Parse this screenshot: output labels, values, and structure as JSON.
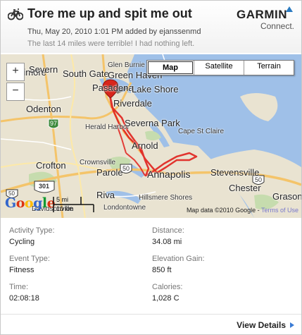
{
  "activity": {
    "title": "Tore me up and spit me out",
    "meta": "Thu, May 20, 2010 1:01 PM added by ejanssenmd",
    "description": "The last 14 miles were terrible! I had nothing left."
  },
  "logo": {
    "brand": "GARMIN",
    "sub": "Connect."
  },
  "map": {
    "type_buttons": {
      "map": "Map",
      "satellite": "Satellite",
      "terrain": "Terrain"
    },
    "zoom_in": "+",
    "zoom_out": "−",
    "google": [
      "G",
      "o",
      "o",
      "g",
      "l",
      "e"
    ],
    "google_colors": [
      "#3366cc",
      "#dd3311",
      "#ffbb00",
      "#3366cc",
      "#119933",
      "#dd3311"
    ],
    "scale_mi": "5 mi",
    "scale_km": "10 km",
    "attribution": "Map data ©2010 Google - ",
    "terms": "Terms of Use",
    "places": {
      "baltimore": "Baltimore",
      "severn": "Severn",
      "south_gate": "South Gate",
      "glen_burnie": "Glen Burnie",
      "green_haven": "Green Haven",
      "pasadena": "Pasadena",
      "lake_shore": "Lake Shore",
      "riverdale": "Riverdale",
      "odenton": "Odenton",
      "herald_harbor": "Herald Harbor",
      "severna_park": "Severna Park",
      "cape_st_claire": "Cape St Claire",
      "crownsville": "Crownsville",
      "arnold": "Arnold",
      "crofton": "Crofton",
      "parole": "Parole",
      "annapolis": "Annapolis",
      "stevensville": "Stevensville",
      "chester": "Chester",
      "grasonville": "Grasonville",
      "riva": "Riva",
      "hillsmere": "Hillsmere Shores",
      "davidsonville": "Davidsonville",
      "londontowne": "Londontowne",
      "route_97": "97",
      "route_50a": "50",
      "route_50b": "50",
      "route_301": "301",
      "route_50c": "50"
    }
  },
  "stats": {
    "activity_type": {
      "label": "Activity Type:",
      "value": "Cycling"
    },
    "event_type": {
      "label": "Event Type:",
      "value": "Fitness"
    },
    "time": {
      "label": "Time:",
      "value": "02:08:18"
    },
    "distance": {
      "label": "Distance:",
      "value": "34.08 mi"
    },
    "elevation": {
      "label": "Elevation Gain:",
      "value": "850 ft"
    },
    "calories": {
      "label": "Calories:",
      "value": "1,028 C"
    }
  },
  "footer": {
    "view_details": "View Details"
  },
  "colors": {
    "route": "#e0201c",
    "water": "#9fc0e8",
    "land": "#e9e3d1",
    "accent": "#3a7bd5"
  }
}
